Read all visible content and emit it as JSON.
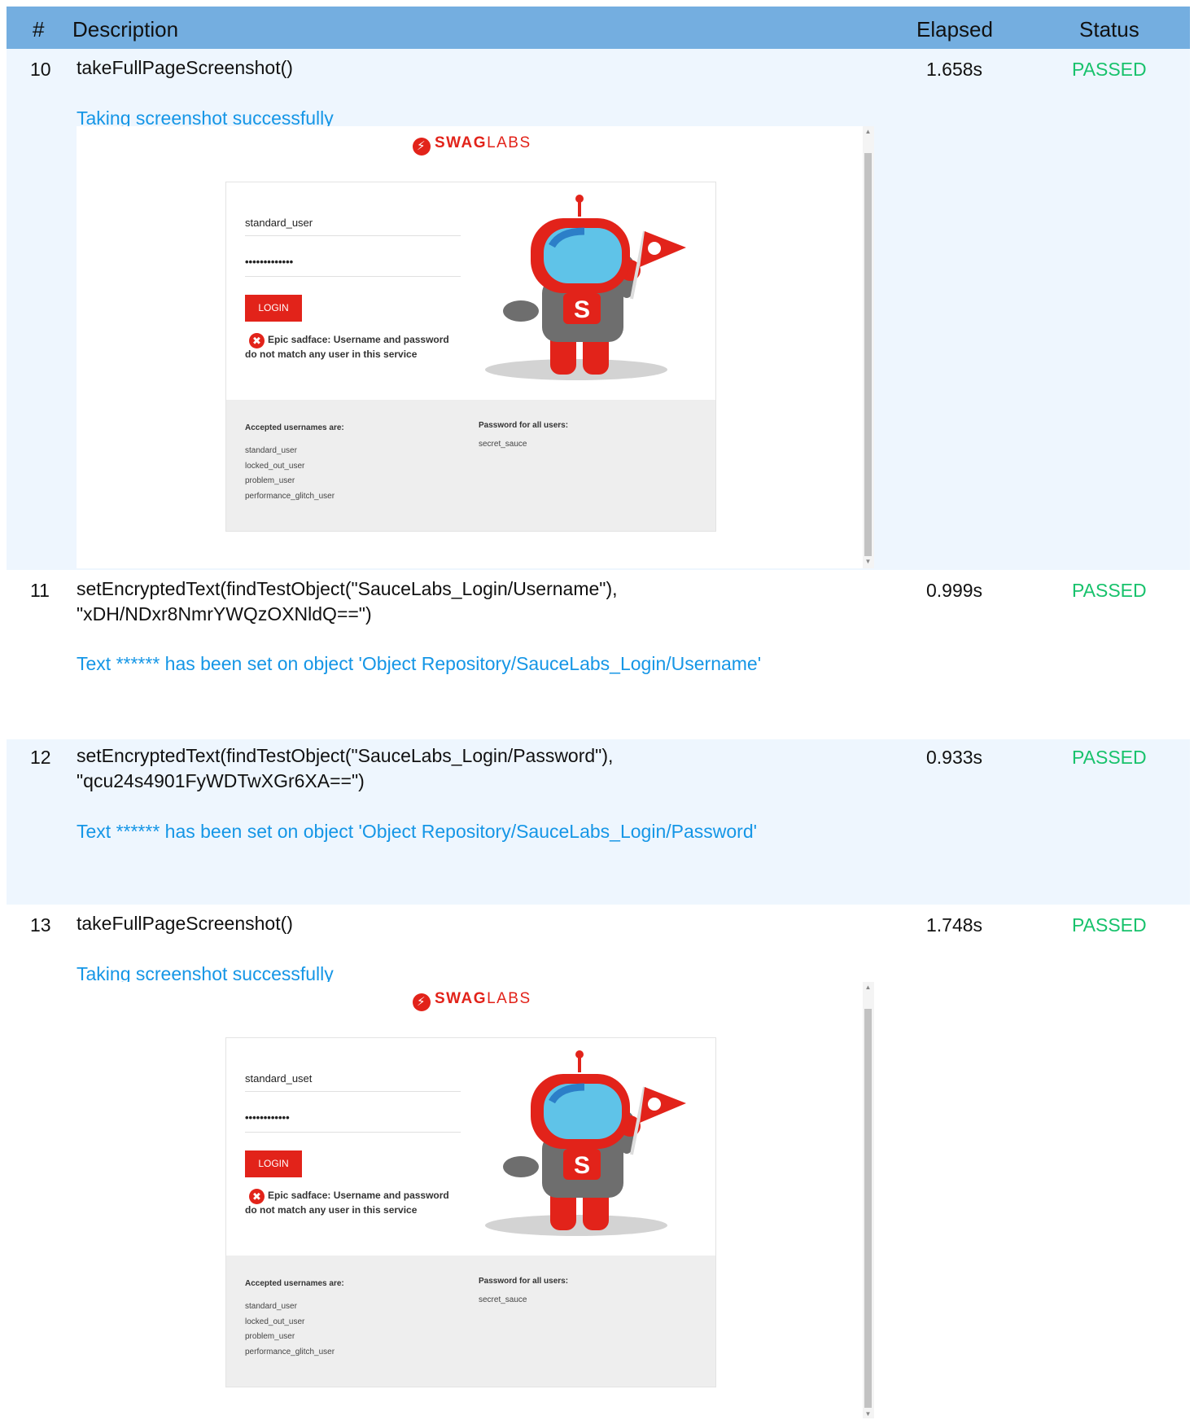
{
  "header": {
    "num": "#",
    "description": "Description",
    "elapsed": "Elapsed",
    "status": "Status"
  },
  "colors": {
    "header": "#74aee0",
    "row_alt": "#eef6fe",
    "passed": "#18c26c",
    "message": "#1596e6",
    "brand_red": "#e2231a"
  },
  "rows": [
    {
      "num": "10",
      "desc1": "takeFullPageScreenshot()",
      "desc2": "",
      "elapsed": "1.658s",
      "status": "PASSED",
      "message": "Taking screenshot successfully"
    },
    {
      "num": "11",
      "desc1": "setEncryptedText(findTestObject(\"SauceLabs_Login/Username\"),",
      "desc2": "\"xDH/NDxr8NmrYWQzOXNldQ==\")",
      "elapsed": "0.999s",
      "status": "PASSED",
      "message": "Text ****** has been set on object 'Object Repository/SauceLabs_Login/Username'"
    },
    {
      "num": "12",
      "desc1": "setEncryptedText(findTestObject(\"SauceLabs_Login/Password\"),",
      "desc2": "\"qcu24s4901FyWDTwXGr6XA==\")",
      "elapsed": "0.933s",
      "status": "PASSED",
      "message": "Text ****** has been set on object 'Object Repository/SauceLabs_Login/Password'"
    },
    {
      "num": "13",
      "desc1": "takeFullPageScreenshot()",
      "desc2": "",
      "elapsed": "1.748s",
      "status": "PASSED",
      "message": "Taking screenshot successfully"
    }
  ],
  "screenshots": [
    {
      "logo_bold": "SWAG",
      "logo_light": "LABS",
      "username": "standard_user",
      "password_mask": "•••••••••••••",
      "login_label": "LOGIN",
      "error_line1": "Epic sadface: Username and password",
      "error_line2": "do not match any user in this service",
      "accepted_heading": "Accepted usernames are:",
      "accepted_users": [
        "standard_user",
        "locked_out_user",
        "problem_user",
        "performance_glitch_user"
      ],
      "password_heading": "Password for all users:",
      "password_value": "secret_sauce"
    },
    {
      "logo_bold": "SWAG",
      "logo_light": "LABS",
      "username": "standard_uset",
      "password_mask": "••••••••••••",
      "login_label": "LOGIN",
      "error_line1": "Epic sadface: Username and password",
      "error_line2": "do not match any user in this service",
      "accepted_heading": "Accepted usernames are:",
      "accepted_users": [
        "standard_user",
        "locked_out_user",
        "problem_user",
        "performance_glitch_user"
      ],
      "password_heading": "Password for all users:",
      "password_value": "secret_sauce"
    }
  ]
}
